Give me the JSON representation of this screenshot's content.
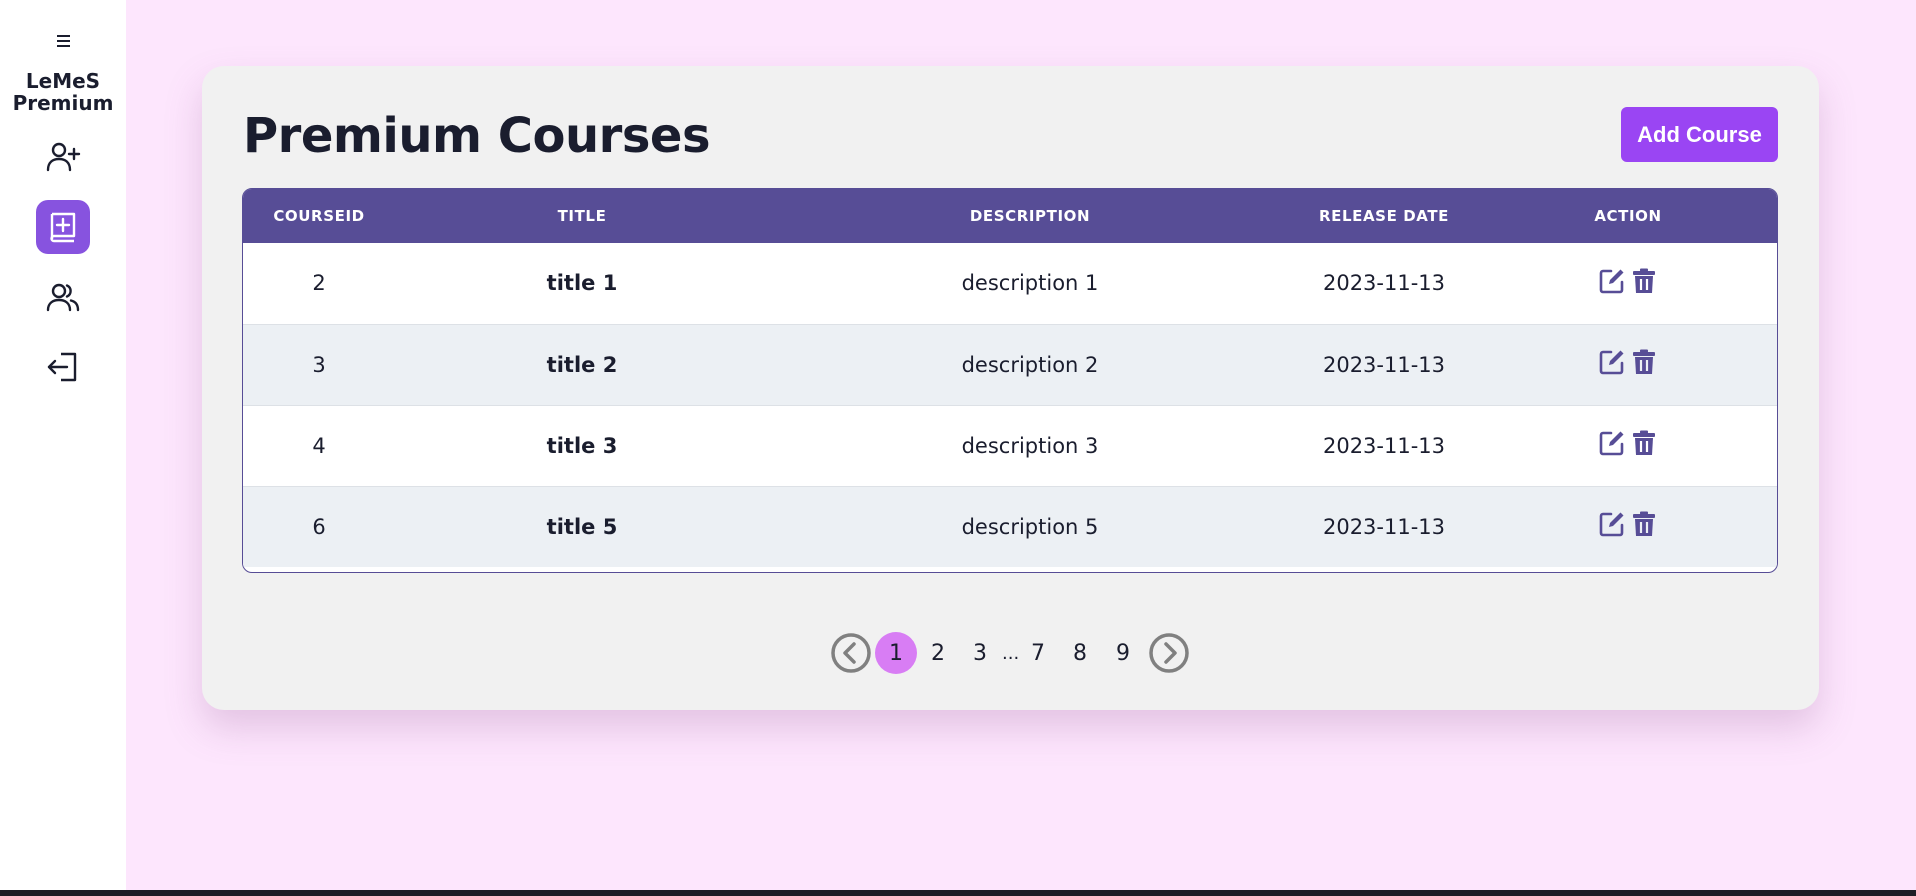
{
  "sidebar": {
    "brand_line1": "LeMeS",
    "brand_line2": "Premium",
    "items": [
      {
        "icon": "add-user-icon"
      },
      {
        "icon": "add-course-icon",
        "active": true
      },
      {
        "icon": "users-icon"
      },
      {
        "icon": "logout-icon"
      }
    ]
  },
  "page": {
    "title": "Premium Courses",
    "add_button": "Add Course"
  },
  "table": {
    "headers": [
      "CourseID",
      "Title",
      "Description",
      "Release Date",
      "Action"
    ],
    "rows": [
      {
        "id": "2",
        "title": "title 1",
        "description": "description 1",
        "release_date": "2023-11-13"
      },
      {
        "id": "3",
        "title": "title 2",
        "description": "description 2",
        "release_date": "2023-11-13"
      },
      {
        "id": "4",
        "title": "title 3",
        "description": "description 3",
        "release_date": "2023-11-13"
      },
      {
        "id": "6",
        "title": "title 5",
        "description": "description 5",
        "release_date": "2023-11-13"
      }
    ]
  },
  "pagination": {
    "pages": [
      "1",
      "2",
      "3",
      "7",
      "8",
      "9"
    ],
    "ellipsis": "...",
    "current": "1"
  },
  "colors": {
    "accent": "#9a45f3",
    "table_header": "#574d96",
    "active_nav": "#8753df",
    "active_page": "#d87df4",
    "background": "#fde6fd"
  }
}
